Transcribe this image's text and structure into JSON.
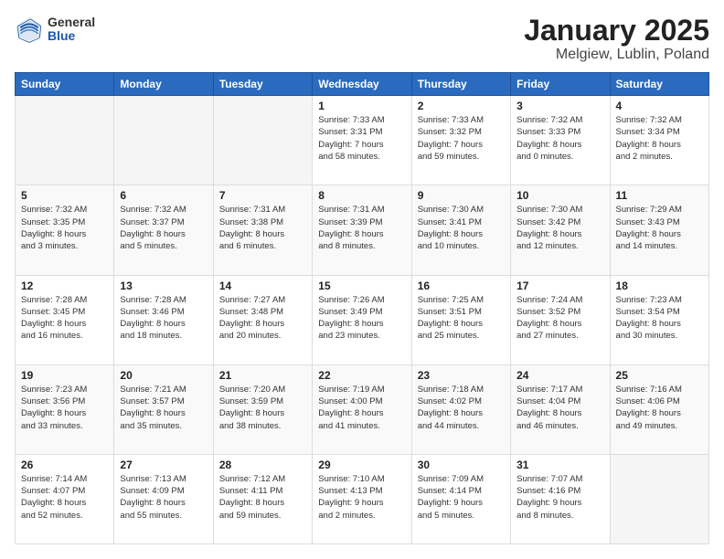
{
  "logo": {
    "general": "General",
    "blue": "Blue"
  },
  "title": "January 2025",
  "subtitle": "Melgiew, Lublin, Poland",
  "weekdays": [
    "Sunday",
    "Monday",
    "Tuesday",
    "Wednesday",
    "Thursday",
    "Friday",
    "Saturday"
  ],
  "weeks": [
    [
      {
        "day": "",
        "info": ""
      },
      {
        "day": "",
        "info": ""
      },
      {
        "day": "",
        "info": ""
      },
      {
        "day": "1",
        "info": "Sunrise: 7:33 AM\nSunset: 3:31 PM\nDaylight: 7 hours\nand 58 minutes."
      },
      {
        "day": "2",
        "info": "Sunrise: 7:33 AM\nSunset: 3:32 PM\nDaylight: 7 hours\nand 59 minutes."
      },
      {
        "day": "3",
        "info": "Sunrise: 7:32 AM\nSunset: 3:33 PM\nDaylight: 8 hours\nand 0 minutes."
      },
      {
        "day": "4",
        "info": "Sunrise: 7:32 AM\nSunset: 3:34 PM\nDaylight: 8 hours\nand 2 minutes."
      }
    ],
    [
      {
        "day": "5",
        "info": "Sunrise: 7:32 AM\nSunset: 3:35 PM\nDaylight: 8 hours\nand 3 minutes."
      },
      {
        "day": "6",
        "info": "Sunrise: 7:32 AM\nSunset: 3:37 PM\nDaylight: 8 hours\nand 5 minutes."
      },
      {
        "day": "7",
        "info": "Sunrise: 7:31 AM\nSunset: 3:38 PM\nDaylight: 8 hours\nand 6 minutes."
      },
      {
        "day": "8",
        "info": "Sunrise: 7:31 AM\nSunset: 3:39 PM\nDaylight: 8 hours\nand 8 minutes."
      },
      {
        "day": "9",
        "info": "Sunrise: 7:30 AM\nSunset: 3:41 PM\nDaylight: 8 hours\nand 10 minutes."
      },
      {
        "day": "10",
        "info": "Sunrise: 7:30 AM\nSunset: 3:42 PM\nDaylight: 8 hours\nand 12 minutes."
      },
      {
        "day": "11",
        "info": "Sunrise: 7:29 AM\nSunset: 3:43 PM\nDaylight: 8 hours\nand 14 minutes."
      }
    ],
    [
      {
        "day": "12",
        "info": "Sunrise: 7:28 AM\nSunset: 3:45 PM\nDaylight: 8 hours\nand 16 minutes."
      },
      {
        "day": "13",
        "info": "Sunrise: 7:28 AM\nSunset: 3:46 PM\nDaylight: 8 hours\nand 18 minutes."
      },
      {
        "day": "14",
        "info": "Sunrise: 7:27 AM\nSunset: 3:48 PM\nDaylight: 8 hours\nand 20 minutes."
      },
      {
        "day": "15",
        "info": "Sunrise: 7:26 AM\nSunset: 3:49 PM\nDaylight: 8 hours\nand 23 minutes."
      },
      {
        "day": "16",
        "info": "Sunrise: 7:25 AM\nSunset: 3:51 PM\nDaylight: 8 hours\nand 25 minutes."
      },
      {
        "day": "17",
        "info": "Sunrise: 7:24 AM\nSunset: 3:52 PM\nDaylight: 8 hours\nand 27 minutes."
      },
      {
        "day": "18",
        "info": "Sunrise: 7:23 AM\nSunset: 3:54 PM\nDaylight: 8 hours\nand 30 minutes."
      }
    ],
    [
      {
        "day": "19",
        "info": "Sunrise: 7:23 AM\nSunset: 3:56 PM\nDaylight: 8 hours\nand 33 minutes."
      },
      {
        "day": "20",
        "info": "Sunrise: 7:21 AM\nSunset: 3:57 PM\nDaylight: 8 hours\nand 35 minutes."
      },
      {
        "day": "21",
        "info": "Sunrise: 7:20 AM\nSunset: 3:59 PM\nDaylight: 8 hours\nand 38 minutes."
      },
      {
        "day": "22",
        "info": "Sunrise: 7:19 AM\nSunset: 4:00 PM\nDaylight: 8 hours\nand 41 minutes."
      },
      {
        "day": "23",
        "info": "Sunrise: 7:18 AM\nSunset: 4:02 PM\nDaylight: 8 hours\nand 44 minutes."
      },
      {
        "day": "24",
        "info": "Sunrise: 7:17 AM\nSunset: 4:04 PM\nDaylight: 8 hours\nand 46 minutes."
      },
      {
        "day": "25",
        "info": "Sunrise: 7:16 AM\nSunset: 4:06 PM\nDaylight: 8 hours\nand 49 minutes."
      }
    ],
    [
      {
        "day": "26",
        "info": "Sunrise: 7:14 AM\nSunset: 4:07 PM\nDaylight: 8 hours\nand 52 minutes."
      },
      {
        "day": "27",
        "info": "Sunrise: 7:13 AM\nSunset: 4:09 PM\nDaylight: 8 hours\nand 55 minutes."
      },
      {
        "day": "28",
        "info": "Sunrise: 7:12 AM\nSunset: 4:11 PM\nDaylight: 8 hours\nand 59 minutes."
      },
      {
        "day": "29",
        "info": "Sunrise: 7:10 AM\nSunset: 4:13 PM\nDaylight: 9 hours\nand 2 minutes."
      },
      {
        "day": "30",
        "info": "Sunrise: 7:09 AM\nSunset: 4:14 PM\nDaylight: 9 hours\nand 5 minutes."
      },
      {
        "day": "31",
        "info": "Sunrise: 7:07 AM\nSunset: 4:16 PM\nDaylight: 9 hours\nand 8 minutes."
      },
      {
        "day": "",
        "info": ""
      }
    ]
  ]
}
